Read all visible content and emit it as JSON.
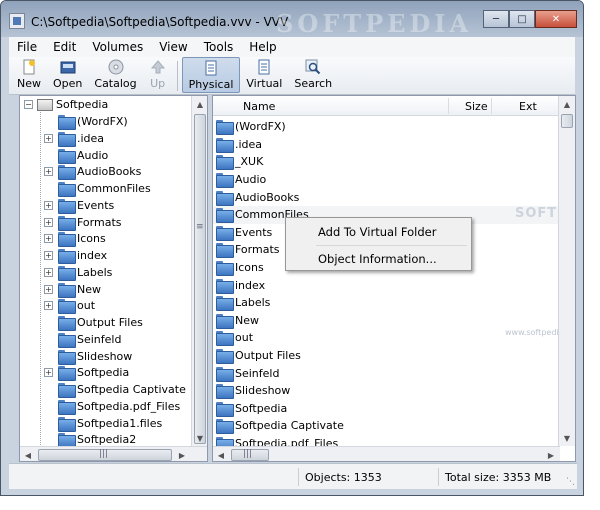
{
  "window": {
    "title": "C:\\Softpedia\\Softpedia\\Softpedia.vvv - VVV",
    "watermark": "SOFTPEDIA"
  },
  "menu": [
    "File",
    "Edit",
    "Volumes",
    "View",
    "Tools",
    "Help"
  ],
  "toolbar": {
    "new": "New",
    "open": "Open",
    "catalog": "Catalog",
    "up": "Up",
    "physical": "Physical",
    "virtual": "Virtual",
    "search": "Search"
  },
  "tree": {
    "root": "Softpedia",
    "items": [
      {
        "label": "(WordFX)",
        "expandable": false
      },
      {
        "label": ".idea",
        "expandable": true
      },
      {
        "label": "Audio",
        "expandable": false
      },
      {
        "label": "AudioBooks",
        "expandable": true
      },
      {
        "label": "CommonFiles",
        "expandable": false
      },
      {
        "label": "Events",
        "expandable": true
      },
      {
        "label": "Formats",
        "expandable": true
      },
      {
        "label": "Icons",
        "expandable": true
      },
      {
        "label": "index",
        "expandable": true
      },
      {
        "label": "Labels",
        "expandable": true
      },
      {
        "label": "New",
        "expandable": true
      },
      {
        "label": "out",
        "expandable": true
      },
      {
        "label": "Output Files",
        "expandable": false
      },
      {
        "label": "Seinfeld",
        "expandable": false
      },
      {
        "label": "Slideshow",
        "expandable": false
      },
      {
        "label": "Softpedia",
        "expandable": true
      },
      {
        "label": "Softpedia Captivate",
        "expandable": false
      },
      {
        "label": "Softpedia.pdf_Files",
        "expandable": false
      },
      {
        "label": "Softpedia1.files",
        "expandable": false
      },
      {
        "label": "Softpedia2",
        "expandable": false
      }
    ]
  },
  "list": {
    "columns": {
      "name": "Name",
      "size": "Size",
      "ext": "Ext"
    },
    "rows": [
      "(WordFX)",
      ".idea",
      "_XUK",
      "Audio",
      "AudioBooks",
      "CommonFiles",
      "Events",
      "Formats",
      "Icons",
      "index",
      "Labels",
      "New",
      "out",
      "Output Files",
      "Seinfeld",
      "Slideshow",
      "Softpedia",
      "Softpedia Captivate",
      "Softpedia.pdf_Files"
    ],
    "watermark": "SOFTPEDIA",
    "watermark_url": "www.softpedia.com"
  },
  "context_menu": {
    "items": [
      "Add To Virtual Folder",
      "Object Information..."
    ]
  },
  "status": {
    "objects": "Objects: 1353",
    "total_size": "Total size: 3353 MB"
  }
}
